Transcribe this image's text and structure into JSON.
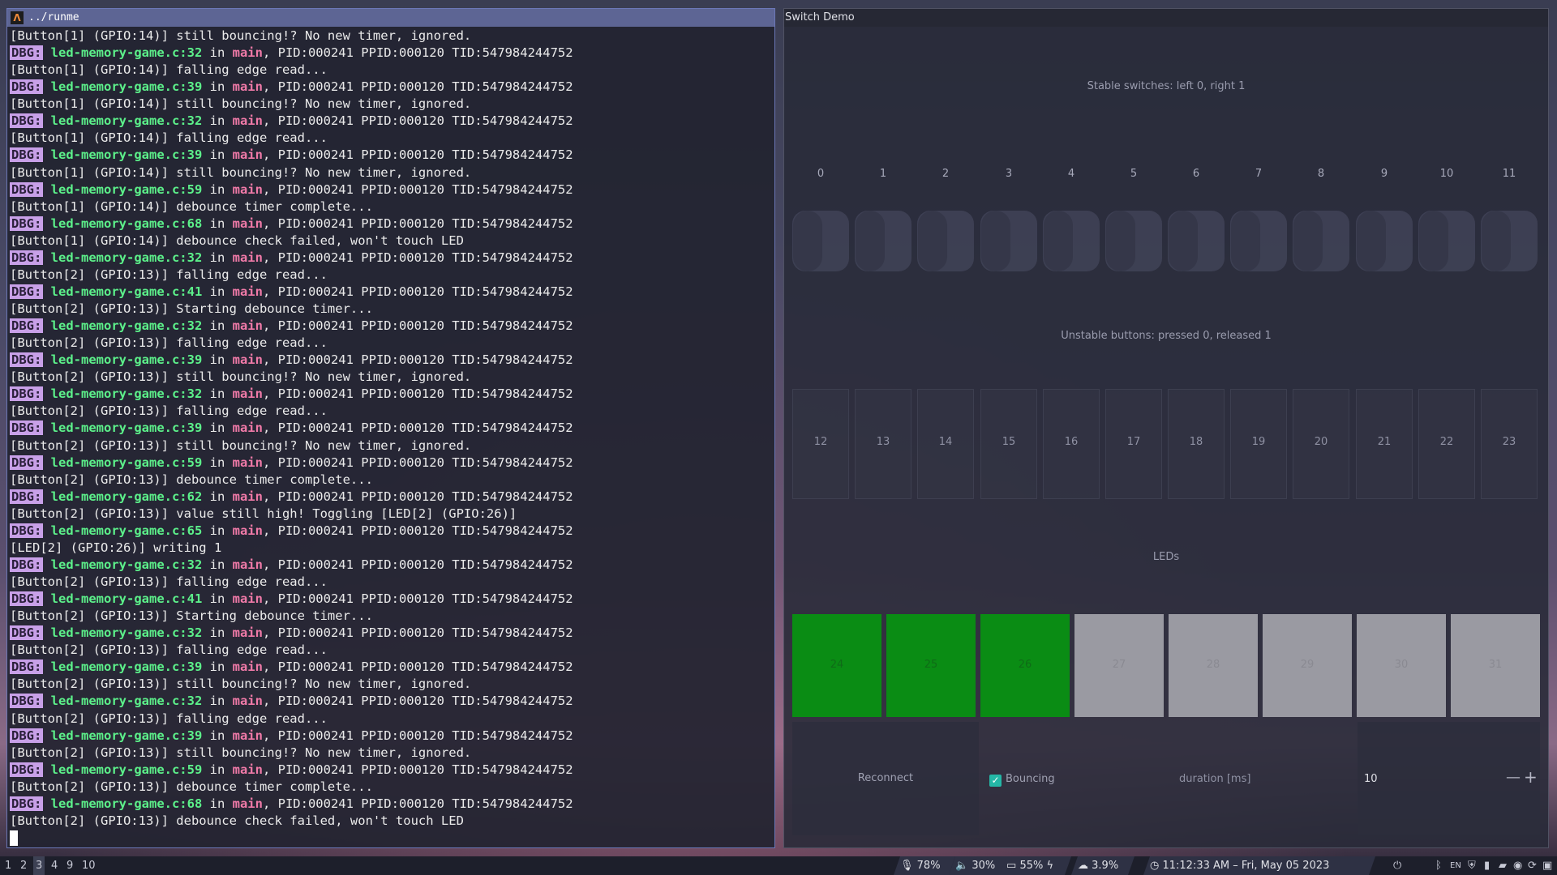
{
  "terminal": {
    "title": "../runme",
    "lines": [
      {
        "type": "plain",
        "text": "[Button[1] (GPIO:14)] still bouncing!? No new timer, ignored."
      },
      {
        "type": "dbg",
        "file": "led-memory-game.c:32",
        "fn": "main",
        "rest": ", PID:000241 PPID:000120 TID:547984244752"
      },
      {
        "type": "plain",
        "text": "[Button[1] (GPIO:14)] falling edge read..."
      },
      {
        "type": "dbg",
        "file": "led-memory-game.c:39",
        "fn": "main",
        "rest": ", PID:000241 PPID:000120 TID:547984244752"
      },
      {
        "type": "plain",
        "text": "[Button[1] (GPIO:14)] still bouncing!? No new timer, ignored."
      },
      {
        "type": "dbg",
        "file": "led-memory-game.c:32",
        "fn": "main",
        "rest": ", PID:000241 PPID:000120 TID:547984244752"
      },
      {
        "type": "plain",
        "text": "[Button[1] (GPIO:14)] falling edge read..."
      },
      {
        "type": "dbg",
        "file": "led-memory-game.c:39",
        "fn": "main",
        "rest": ", PID:000241 PPID:000120 TID:547984244752"
      },
      {
        "type": "plain",
        "text": "[Button[1] (GPIO:14)] still bouncing!? No new timer, ignored."
      },
      {
        "type": "dbg",
        "file": "led-memory-game.c:59",
        "fn": "main",
        "rest": ", PID:000241 PPID:000120 TID:547984244752"
      },
      {
        "type": "plain",
        "text": "[Button[1] (GPIO:14)] debounce timer complete..."
      },
      {
        "type": "dbg",
        "file": "led-memory-game.c:68",
        "fn": "main",
        "rest": ", PID:000241 PPID:000120 TID:547984244752"
      },
      {
        "type": "plain",
        "text": "[Button[1] (GPIO:14)] debounce check failed, won't touch LED"
      },
      {
        "type": "dbg",
        "file": "led-memory-game.c:32",
        "fn": "main",
        "rest": ", PID:000241 PPID:000120 TID:547984244752"
      },
      {
        "type": "plain",
        "text": "[Button[2] (GPIO:13)] falling edge read..."
      },
      {
        "type": "dbg",
        "file": "led-memory-game.c:41",
        "fn": "main",
        "rest": ", PID:000241 PPID:000120 TID:547984244752"
      },
      {
        "type": "plain",
        "text": "[Button[2] (GPIO:13)] Starting debounce timer..."
      },
      {
        "type": "dbg",
        "file": "led-memory-game.c:32",
        "fn": "main",
        "rest": ", PID:000241 PPID:000120 TID:547984244752"
      },
      {
        "type": "plain",
        "text": "[Button[2] (GPIO:13)] falling edge read..."
      },
      {
        "type": "dbg",
        "file": "led-memory-game.c:39",
        "fn": "main",
        "rest": ", PID:000241 PPID:000120 TID:547984244752"
      },
      {
        "type": "plain",
        "text": "[Button[2] (GPIO:13)] still bouncing!? No new timer, ignored."
      },
      {
        "type": "dbg",
        "file": "led-memory-game.c:32",
        "fn": "main",
        "rest": ", PID:000241 PPID:000120 TID:547984244752"
      },
      {
        "type": "plain",
        "text": "[Button[2] (GPIO:13)] falling edge read..."
      },
      {
        "type": "dbg",
        "file": "led-memory-game.c:39",
        "fn": "main",
        "rest": ", PID:000241 PPID:000120 TID:547984244752"
      },
      {
        "type": "plain",
        "text": "[Button[2] (GPIO:13)] still bouncing!? No new timer, ignored."
      },
      {
        "type": "dbg",
        "file": "led-memory-game.c:59",
        "fn": "main",
        "rest": ", PID:000241 PPID:000120 TID:547984244752"
      },
      {
        "type": "plain",
        "text": "[Button[2] (GPIO:13)] debounce timer complete..."
      },
      {
        "type": "dbg",
        "file": "led-memory-game.c:62",
        "fn": "main",
        "rest": ", PID:000241 PPID:000120 TID:547984244752"
      },
      {
        "type": "plain",
        "text": "[Button[2] (GPIO:13)] value still high! Toggling [LED[2] (GPIO:26)]"
      },
      {
        "type": "dbg",
        "file": "led-memory-game.c:65",
        "fn": "main",
        "rest": ", PID:000241 PPID:000120 TID:547984244752"
      },
      {
        "type": "plain",
        "text": "[LED[2] (GPIO:26)] writing 1"
      },
      {
        "type": "dbg",
        "file": "led-memory-game.c:32",
        "fn": "main",
        "rest": ", PID:000241 PPID:000120 TID:547984244752"
      },
      {
        "type": "plain",
        "text": "[Button[2] (GPIO:13)] falling edge read..."
      },
      {
        "type": "dbg",
        "file": "led-memory-game.c:41",
        "fn": "main",
        "rest": ", PID:000241 PPID:000120 TID:547984244752"
      },
      {
        "type": "plain",
        "text": "[Button[2] (GPIO:13)] Starting debounce timer..."
      },
      {
        "type": "dbg",
        "file": "led-memory-game.c:32",
        "fn": "main",
        "rest": ", PID:000241 PPID:000120 TID:547984244752"
      },
      {
        "type": "plain",
        "text": "[Button[2] (GPIO:13)] falling edge read..."
      },
      {
        "type": "dbg",
        "file": "led-memory-game.c:39",
        "fn": "main",
        "rest": ", PID:000241 PPID:000120 TID:547984244752"
      },
      {
        "type": "plain",
        "text": "[Button[2] (GPIO:13)] still bouncing!? No new timer, ignored."
      },
      {
        "type": "dbg",
        "file": "led-memory-game.c:32",
        "fn": "main",
        "rest": ", PID:000241 PPID:000120 TID:547984244752"
      },
      {
        "type": "plain",
        "text": "[Button[2] (GPIO:13)] falling edge read..."
      },
      {
        "type": "dbg",
        "file": "led-memory-game.c:39",
        "fn": "main",
        "rest": ", PID:000241 PPID:000120 TID:547984244752"
      },
      {
        "type": "plain",
        "text": "[Button[2] (GPIO:13)] still bouncing!? No new timer, ignored."
      },
      {
        "type": "dbg",
        "file": "led-memory-game.c:59",
        "fn": "main",
        "rest": ", PID:000241 PPID:000120 TID:547984244752"
      },
      {
        "type": "plain",
        "text": "[Button[2] (GPIO:13)] debounce timer complete..."
      },
      {
        "type": "dbg",
        "file": "led-memory-game.c:68",
        "fn": "main",
        "rest": ", PID:000241 PPID:000120 TID:547984244752"
      },
      {
        "type": "plain",
        "text": "[Button[2] (GPIO:13)] debounce check failed, won't touch LED"
      }
    ],
    "dbg_tag": "DBG:",
    "in_word": " in "
  },
  "app": {
    "title": "Switch Demo",
    "stable_label": "Stable switches: left 0, right 1",
    "switch_numbers": [
      "0",
      "1",
      "2",
      "3",
      "4",
      "5",
      "6",
      "7",
      "8",
      "9",
      "10",
      "11"
    ],
    "unstable_label": "Unstable buttons: pressed 0, released 1",
    "button_numbers": [
      "12",
      "13",
      "14",
      "15",
      "16",
      "17",
      "18",
      "19",
      "20",
      "21",
      "22",
      "23"
    ],
    "leds_label": "LEDs",
    "leds": [
      {
        "number": "24",
        "on": true
      },
      {
        "number": "25",
        "on": true
      },
      {
        "number": "26",
        "on": true
      },
      {
        "number": "27",
        "on": false
      },
      {
        "number": "28",
        "on": false
      },
      {
        "number": "29",
        "on": false
      },
      {
        "number": "30",
        "on": false
      },
      {
        "number": "31",
        "on": false
      }
    ],
    "led_on_color": "#0a8c14",
    "led_off_color": "#9a9aa2",
    "reconnect_label": "Reconnect",
    "bouncing_label": "Bouncing",
    "bouncing_checked": true,
    "duration_label": "duration [ms]",
    "duration_value": "10",
    "minus_label": "—",
    "plus_label": "+"
  },
  "taskbar": {
    "workspaces": [
      "1",
      "2",
      "3",
      "4",
      "9",
      "10"
    ],
    "active_workspace": "3",
    "mic": "78%",
    "volume": "30%",
    "brightness": "55%",
    "cpu": "3.9%",
    "clock": "11:12:33 AM – Fri, May 05 2023",
    "tray_text": "EN"
  }
}
